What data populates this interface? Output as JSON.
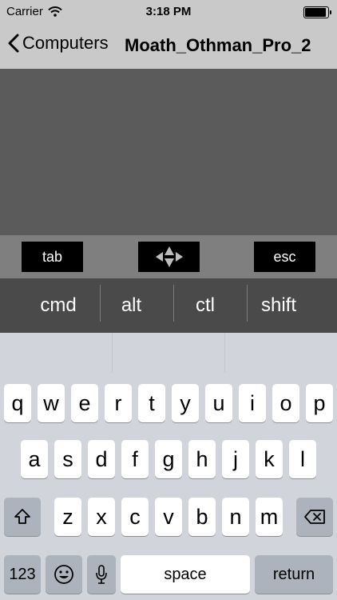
{
  "status_bar": {
    "carrier": "Carrier",
    "time": "3:18 PM",
    "battery_level": 1.0
  },
  "nav": {
    "back_label": "Computers",
    "title": "Moath_Othman_Pro_2"
  },
  "special_keys": {
    "tab": "tab",
    "esc": "esc"
  },
  "modifiers": [
    "cmd",
    "alt",
    "ctl",
    "shift"
  ],
  "keyboard": {
    "row1": [
      "q",
      "w",
      "e",
      "r",
      "t",
      "y",
      "u",
      "i",
      "o",
      "p"
    ],
    "row2": [
      "a",
      "s",
      "d",
      "f",
      "g",
      "h",
      "j",
      "k",
      "l"
    ],
    "row3": [
      "z",
      "x",
      "c",
      "v",
      "b",
      "n",
      "m"
    ],
    "numbers_label": "123",
    "space_label": "space",
    "return_label": "return"
  },
  "colors": {
    "trackpad": "#5b5b5b",
    "key_bar": "#7f7f7f",
    "modifier_bar": "#4a4a4a"
  },
  "icons": [
    "wifi-icon",
    "battery-icon",
    "back-chevron-icon",
    "arrow-pad-icon",
    "shift-icon",
    "delete-icon",
    "emoji-icon",
    "microphone-icon"
  ]
}
